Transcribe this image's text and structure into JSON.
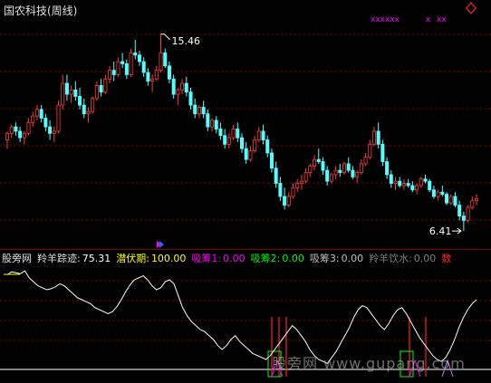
{
  "window": {
    "title": "国农科技(周线)"
  },
  "colors": {
    "up": "#ff3c3c",
    "down": "#54ffff",
    "grid": "#8b0000",
    "indicator_line": "#ffffff",
    "xx_marks": "#ff00ff",
    "diamond": "#ff2020"
  },
  "main_panel": {
    "high_label": "15.46",
    "low_label": "6.41",
    "top_marks": [
      "xxxxxx",
      "x",
      "xx"
    ],
    "diamond_icon": "diamond-icon"
  },
  "chart_data": {
    "type": "candlestick",
    "title": "国农科技(周线)",
    "xlabel": "",
    "ylabel": "",
    "ylim": [
      6.0,
      16.2
    ],
    "annotations": [
      {
        "text": "15.46",
        "value": 15.46
      },
      {
        "text": "6.41",
        "value": 6.41
      }
    ],
    "candles": [
      [
        10.6,
        11.0,
        10.2,
        10.9
      ],
      [
        10.9,
        11.3,
        10.7,
        11.2
      ],
      [
        11.2,
        11.4,
        10.8,
        11.0
      ],
      [
        11.0,
        11.2,
        10.5,
        10.7
      ],
      [
        10.7,
        11.0,
        10.4,
        10.9
      ],
      [
        10.9,
        11.6,
        10.8,
        11.4
      ],
      [
        11.4,
        11.9,
        11.2,
        11.7
      ],
      [
        11.7,
        12.2,
        11.5,
        12.0
      ],
      [
        12.0,
        12.2,
        11.4,
        11.6
      ],
      [
        11.6,
        11.8,
        11.0,
        11.2
      ],
      [
        11.2,
        11.5,
        10.6,
        10.9
      ],
      [
        10.9,
        11.2,
        10.5,
        11.0
      ],
      [
        11.0,
        12.4,
        10.9,
        12.2
      ],
      [
        12.2,
        13.6,
        12.0,
        13.2
      ],
      [
        13.2,
        13.6,
        12.4,
        12.7
      ],
      [
        12.7,
        13.1,
        12.3,
        12.9
      ],
      [
        12.9,
        13.3,
        12.4,
        12.6
      ],
      [
        12.6,
        13.0,
        12.0,
        12.2
      ],
      [
        12.2,
        12.5,
        11.6,
        11.8
      ],
      [
        11.8,
        12.1,
        11.4,
        11.9
      ],
      [
        11.9,
        12.6,
        11.8,
        12.5
      ],
      [
        12.5,
        13.3,
        12.4,
        13.1
      ],
      [
        13.1,
        13.4,
        12.6,
        12.8
      ],
      [
        12.8,
        13.6,
        12.7,
        13.4
      ],
      [
        13.4,
        14.0,
        13.2,
        13.8
      ],
      [
        13.8,
        14.2,
        13.3,
        13.6
      ],
      [
        13.6,
        14.4,
        13.5,
        14.2
      ],
      [
        14.2,
        14.6,
        13.9,
        14.1
      ],
      [
        14.1,
        14.3,
        13.4,
        13.6
      ],
      [
        13.6,
        14.8,
        13.5,
        14.6
      ],
      [
        14.6,
        15.2,
        14.3,
        14.5
      ],
      [
        14.5,
        14.7,
        14.0,
        14.2
      ],
      [
        14.2,
        14.4,
        13.5,
        13.7
      ],
      [
        13.7,
        13.9,
        13.1,
        13.3
      ],
      [
        13.3,
        13.6,
        12.8,
        13.4
      ],
      [
        13.4,
        14.0,
        13.3,
        13.8
      ],
      [
        13.8,
        15.46,
        13.7,
        14.6
      ],
      [
        14.6,
        14.8,
        13.9,
        14.0
      ],
      [
        14.0,
        14.2,
        13.2,
        13.4
      ],
      [
        13.4,
        13.6,
        12.5,
        12.7
      ],
      [
        12.7,
        13.0,
        12.2,
        12.9
      ],
      [
        12.9,
        13.4,
        12.7,
        13.2
      ],
      [
        13.2,
        13.5,
        12.6,
        12.8
      ],
      [
        12.8,
        13.0,
        12.0,
        12.2
      ],
      [
        12.2,
        12.5,
        11.6,
        11.8
      ],
      [
        11.8,
        12.2,
        11.6,
        12.1
      ],
      [
        12.1,
        12.4,
        11.6,
        11.8
      ],
      [
        11.8,
        12.0,
        11.0,
        11.2
      ],
      [
        11.2,
        11.6,
        11.0,
        11.5
      ],
      [
        11.5,
        11.7,
        10.9,
        11.1
      ],
      [
        11.1,
        11.4,
        10.6,
        10.8
      ],
      [
        10.8,
        11.1,
        10.2,
        10.4
      ],
      [
        10.4,
        10.9,
        10.2,
        10.7
      ],
      [
        10.7,
        11.3,
        10.6,
        11.1
      ],
      [
        11.1,
        11.4,
        10.5,
        10.7
      ],
      [
        10.7,
        10.9,
        10.0,
        10.2
      ],
      [
        10.2,
        10.5,
        9.5,
        9.7
      ],
      [
        9.7,
        10.3,
        9.6,
        10.1
      ],
      [
        10.1,
        10.8,
        10.0,
        10.6
      ],
      [
        10.6,
        11.2,
        10.5,
        11.0
      ],
      [
        11.0,
        11.3,
        10.4,
        10.6
      ],
      [
        10.6,
        10.8,
        9.8,
        10.0
      ],
      [
        10.0,
        10.2,
        9.1,
        9.3
      ],
      [
        9.3,
        9.6,
        8.4,
        8.6
      ],
      [
        8.6,
        8.9,
        7.8,
        8.0
      ],
      [
        8.0,
        8.4,
        7.4,
        7.6
      ],
      [
        7.6,
        8.2,
        7.5,
        8.0
      ],
      [
        8.0,
        8.6,
        7.9,
        8.4
      ],
      [
        8.4,
        8.8,
        8.2,
        8.6
      ],
      [
        8.6,
        9.0,
        8.3,
        8.7
      ],
      [
        8.7,
        9.3,
        8.6,
        9.1
      ],
      [
        9.1,
        9.5,
        8.9,
        9.4
      ],
      [
        9.4,
        9.9,
        9.2,
        9.7
      ],
      [
        9.7,
        10.2,
        9.5,
        9.6
      ],
      [
        9.6,
        9.8,
        9.0,
        9.2
      ],
      [
        9.2,
        9.4,
        8.5,
        8.7
      ],
      [
        8.7,
        9.1,
        8.6,
        9.0
      ],
      [
        9.0,
        9.4,
        8.8,
        9.2
      ],
      [
        9.2,
        9.5,
        8.9,
        9.1
      ],
      [
        9.1,
        9.6,
        9.0,
        9.5
      ],
      [
        9.5,
        9.8,
        9.1,
        9.2
      ],
      [
        9.2,
        9.4,
        8.8,
        8.9
      ],
      [
        8.9,
        9.2,
        8.6,
        9.1
      ],
      [
        9.1,
        9.7,
        9.0,
        9.5
      ],
      [
        9.5,
        10.0,
        9.4,
        9.8
      ],
      [
        9.8,
        10.6,
        9.7,
        10.4
      ],
      [
        10.4,
        11.2,
        10.3,
        11.0
      ],
      [
        11.0,
        11.4,
        10.2,
        10.4
      ],
      [
        10.4,
        10.6,
        9.4,
        9.6
      ],
      [
        9.6,
        9.8,
        8.8,
        9.0
      ],
      [
        9.0,
        9.2,
        8.4,
        8.6
      ],
      [
        8.6,
        8.9,
        8.3,
        8.7
      ],
      [
        8.7,
        8.9,
        8.4,
        8.5
      ],
      [
        8.5,
        8.8,
        8.3,
        8.6
      ],
      [
        8.6,
        8.8,
        8.4,
        8.5
      ],
      [
        8.5,
        8.7,
        8.2,
        8.3
      ],
      [
        8.3,
        8.6,
        8.1,
        8.5
      ],
      [
        8.5,
        8.9,
        8.4,
        8.8
      ],
      [
        8.8,
        9.0,
        8.6,
        8.7
      ],
      [
        8.7,
        8.8,
        8.2,
        8.3
      ],
      [
        8.3,
        8.5,
        7.9,
        8.0
      ],
      [
        8.0,
        8.3,
        7.8,
        8.2
      ],
      [
        8.2,
        8.5,
        8.0,
        8.1
      ],
      [
        8.1,
        8.2,
        7.6,
        7.7
      ],
      [
        7.7,
        8.1,
        7.6,
        8.0
      ],
      [
        8.0,
        8.2,
        7.5,
        7.6
      ],
      [
        7.6,
        7.8,
        6.9,
        7.1
      ],
      [
        7.1,
        7.3,
        6.41,
        6.9
      ],
      [
        6.9,
        7.6,
        6.8,
        7.5
      ],
      [
        7.5,
        8.0,
        7.4,
        7.8
      ],
      [
        7.8,
        8.1,
        7.6,
        7.9
      ]
    ],
    "indicator": {
      "name": "羚羊踪迹",
      "ylim": [
        0,
        100
      ],
      "values": [
        95,
        98,
        97,
        96,
        99,
        92,
        88,
        84,
        82,
        80,
        81,
        83,
        86,
        84,
        80,
        76,
        72,
        70,
        68,
        66,
        62,
        60,
        58,
        56,
        58,
        63,
        70,
        78,
        85,
        90,
        92,
        94,
        90,
        84,
        80,
        82,
        88,
        90,
        86,
        74,
        62,
        54,
        48,
        44,
        40,
        38,
        34,
        30,
        24,
        20,
        24,
        30,
        34,
        28,
        24,
        20,
        16,
        14,
        12,
        10,
        14,
        20,
        26,
        32,
        38,
        44,
        40,
        34,
        28,
        20,
        14,
        10,
        8,
        6,
        12,
        18,
        26,
        34,
        42,
        52,
        60,
        64,
        62,
        56,
        50,
        44,
        40,
        46,
        54,
        60,
        62,
        56,
        48,
        40,
        32,
        26,
        20,
        14,
        10,
        8,
        12,
        20,
        30,
        42,
        52,
        60,
        66,
        70
      ]
    }
  },
  "lower_panel": {
    "label_zone": "股旁网",
    "label_track": "羚羊踪迹:",
    "value_track": "75.31",
    "label_latent": "潜伏期:",
    "value_latent": "100.00",
    "label_absorb1": "吸筹1:",
    "value_absorb1": "0.00",
    "label_absorb2": "吸筹2:",
    "value_absorb2": "0.00",
    "label_absorb3": "吸筹3:",
    "value_absorb3": "0.00",
    "label_drink": "羚羊饮水:",
    "value_drink": "0.00",
    "label_signal": "数",
    "watermark": "股旁网 www.gupang.com"
  }
}
